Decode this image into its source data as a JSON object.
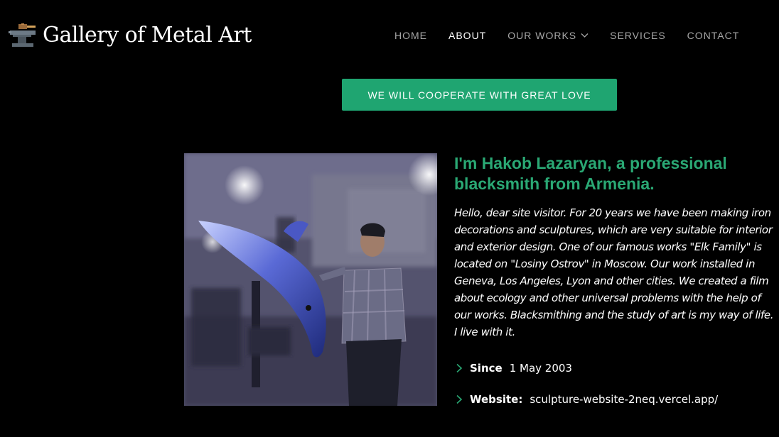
{
  "header": {
    "logo_text": "Gallery of Metal Art",
    "logo_icon": "anvil-hammer-icon"
  },
  "nav": {
    "items": [
      {
        "label": "HOME",
        "active": false
      },
      {
        "label": "ABOUT",
        "active": true
      },
      {
        "label": "OUR WORKS",
        "active": false,
        "has_dropdown": true
      },
      {
        "label": "SERVICES",
        "active": false
      },
      {
        "label": "CONTACT",
        "active": false
      }
    ]
  },
  "cta": {
    "label": "WE WILL COOPERATE WITH GREAT LOVE",
    "color": "#1fa571"
  },
  "about": {
    "title": "I'm Hakob Lazaryan, a professional blacksmith from Armenia.",
    "body": "Hello, dear site visitor. For 20 years we have been making iron decorations and sculptures, which are very suitable for interior and exterior design. One of our famous works \"Elk Family\" is located on \"Losiny Ostrov\" in Moscow. Our work installed in Geneva, Los Angeles, Lyon and other cities. We created a film about ecology and other universal problems with the help of our works. Blacksmithing and the study of art is my way of life. I live with it.",
    "accent_color": "#2aa874",
    "info": [
      {
        "label": "Since",
        "value": "1 May 2003"
      },
      {
        "label": "Website:",
        "value": "sculpture-website-2neq.vercel.app/"
      }
    ]
  }
}
